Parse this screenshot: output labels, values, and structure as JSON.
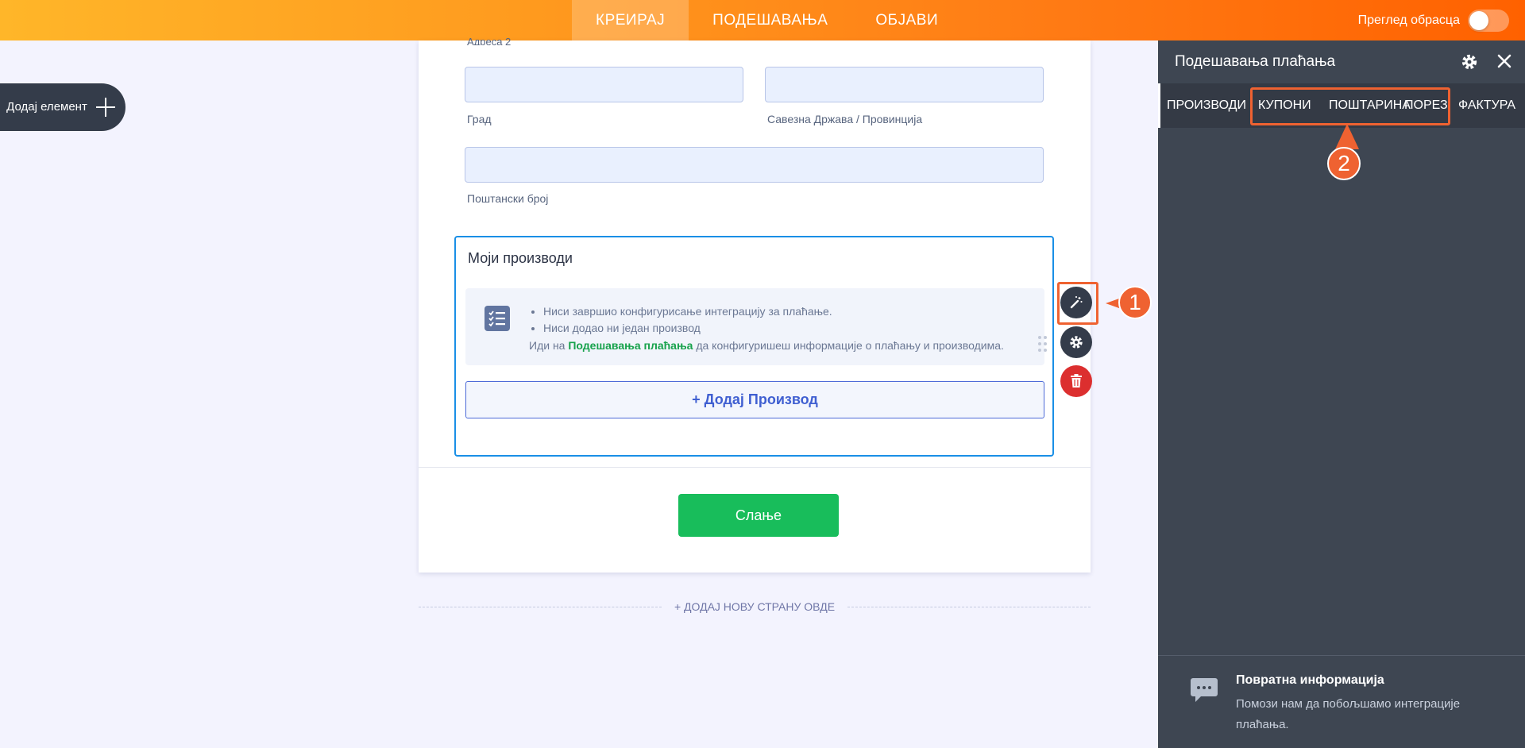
{
  "topbar": {
    "tabs": [
      {
        "label": "КРЕИРАЈ",
        "active": true
      },
      {
        "label": "ПОДЕШАВАЊА",
        "active": false
      },
      {
        "label": "ОБЈАВИ",
        "active": false
      }
    ],
    "preview_label": "Преглед обрасца",
    "preview_on": false
  },
  "sidebar_left": {
    "add_element_label": "Додај елемент"
  },
  "form": {
    "address_line2_label": "Адреса 2",
    "city_label": "Град",
    "state_label": "Савезна Држава / Провинција",
    "zip_label": "Поштански број",
    "products": {
      "title": "Моји производи",
      "warnings": [
        "Ниси завршио конфигурисање интеграцију за плаћање.",
        "Ниси додао ни један производ"
      ],
      "go_prefix": "Иди на ",
      "go_link": "Подешавања плаћања",
      "go_suffix": " да конфигуришеш информације о плаћању и производима.",
      "add_product_label": "+ Додај Производ"
    },
    "submit_label": "Слање",
    "add_page_label": "+ ДОДАЈ НОВУ СТРАНУ ОВДЕ"
  },
  "field_tools": {
    "icons": [
      "magic-wand-icon",
      "gear-icon",
      "trash-icon"
    ]
  },
  "annotations": {
    "badge_1": "1",
    "badge_2": "2",
    "color": "#ef6231"
  },
  "panel": {
    "title": "Подешавања плаћања",
    "tabs": [
      {
        "label": "ПРОИЗВОДИ",
        "active": true
      },
      {
        "label": "КУПОНИ",
        "active": false
      },
      {
        "label": "ПОШТАРИНА",
        "active": false
      },
      {
        "label": "ПОРЕЗ",
        "active": false
      },
      {
        "label": "ФАКТУРА",
        "active": false
      }
    ],
    "feedback": {
      "title": "Повратна информација",
      "text": "Помози нам да побољшамо интеграције плаћања."
    }
  },
  "colors": {
    "brand_orange": "#ff6100",
    "submit_green": "#18bd5b",
    "selected_border": "#1a8fe6",
    "panel_bg": "#3e4652"
  }
}
